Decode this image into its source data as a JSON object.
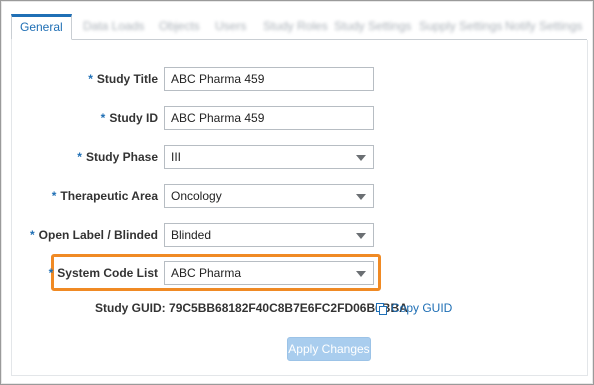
{
  "tabs": [
    {
      "label": "General",
      "active": true
    },
    {
      "label": "Data Loads",
      "active": false
    },
    {
      "label": "Objects",
      "active": false
    },
    {
      "label": "Users",
      "active": false
    },
    {
      "label": "Study Roles",
      "active": false
    },
    {
      "label": "Study Settings",
      "active": false
    },
    {
      "label": "Supply Settings",
      "active": false
    },
    {
      "label": "Notify Settings",
      "active": false
    }
  ],
  "form": {
    "required_marker": "*",
    "study_title": {
      "label": "Study Title",
      "value": "ABC Pharma 459"
    },
    "study_id": {
      "label": "Study ID",
      "value": "ABC Pharma 459"
    },
    "study_phase": {
      "label": "Study Phase",
      "value": "III"
    },
    "therapeutic_area": {
      "label": "Therapeutic Area",
      "value": "Oncology"
    },
    "open_label_blinded": {
      "label": "Open Label / Blinded",
      "value": "Blinded"
    },
    "system_code_list": {
      "label": "System Code List",
      "value": "ABC Pharma"
    }
  },
  "guid": {
    "label": "Study GUID:",
    "value": "79C5BB68182F40C8B7E6FC2FD06B6BBA",
    "copy_label": "Copy GUID"
  },
  "actions": {
    "apply_label": "Apply Changes"
  },
  "colors": {
    "accent": "#1f6fb5",
    "highlight": "#f08a24",
    "apply_disabled_bg": "#a9cdee"
  },
  "icons": {
    "copy": "copy-icon",
    "dropdown": "chevron-down-icon"
  }
}
